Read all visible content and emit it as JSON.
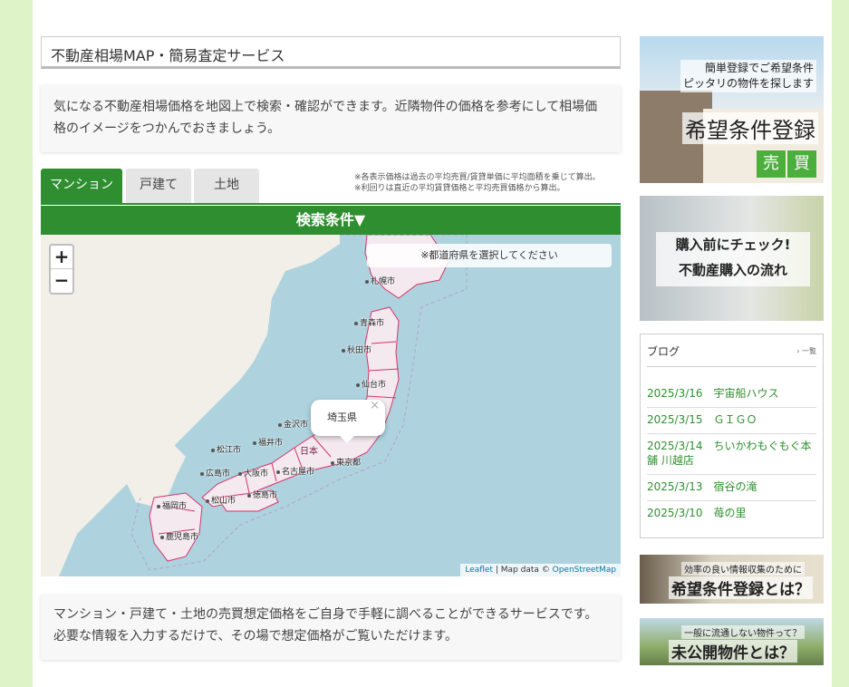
{
  "main": {
    "title": "不動産相場MAP・簡易査定サービス",
    "intro": "気になる不動産相場価格を地図上で検索・確認ができます。近隣物件の価格を参考にして相場価格のイメージをつかんでおきましょう。",
    "tabs": [
      {
        "label": "マンション",
        "active": true
      },
      {
        "label": "戸建て",
        "active": false
      },
      {
        "label": "土地",
        "active": false
      }
    ],
    "notes": [
      "※各表示価格は過去の平均売買/賃貸単価に平均面積を乗じて算出。",
      "※利回りは直近の平均賃貸価格と平均売買価格から算出。"
    ],
    "search_label": "検索条件▼",
    "description": "マンション・戸建て・土地の売買想定価格をご自身で手軽に調べることができるサービスです。 必要な情報を入力するだけで、その場で想定価格がご覧いただけます。"
  },
  "map": {
    "zoom_in": "+",
    "zoom_out": "−",
    "prefecture_prompt": "※都道府県を選択してください",
    "popup_label": "埼玉県",
    "popup_close": "×",
    "attribution_leaflet": "Leaflet",
    "attribution_sep": " | Map data © ",
    "attribution_osm": "OpenStreetMap",
    "cities": [
      "札幌市",
      "青森市",
      "秋田市",
      "仙台市",
      "金沢市",
      "福井市",
      "松江市",
      "広島市",
      "大阪市",
      "名古屋市",
      "東京都",
      "福岡市",
      "松山市",
      "徳島市",
      "鹿児島市",
      "日本"
    ],
    "colors": {
      "land": "#f2efe9",
      "sea": "#aed3df",
      "border": "#d2356b"
    }
  },
  "sidebar": {
    "banner1": {
      "line1": "簡単登録でご希望条件",
      "line2": "ピッタリの物件を探します",
      "title": "希望条件登録",
      "badges": [
        "売",
        "買"
      ]
    },
    "banner2": {
      "line1": "購入前にチェック!",
      "line2": "不動産購入の流れ"
    },
    "blog": {
      "heading": "ブログ",
      "more": "一覧",
      "items": [
        "2025/3/16　宇宙船ハウス",
        "2025/3/15　ＧＩＧＯ",
        "2025/3/14　ちいかわもぐもぐ本舗 川越店",
        "2025/3/13　宿谷の滝",
        "2025/3/10　苺の里"
      ]
    },
    "banner3": {
      "line1": "効率の良い情報収集のために",
      "line2": "希望条件登録とは？"
    },
    "banner4": {
      "line1": "一般に流通しない物件って？",
      "line2": "未公開物件とは？"
    }
  },
  "colors": {
    "accent": "#2f8f30",
    "background": "#dff3c9"
  }
}
